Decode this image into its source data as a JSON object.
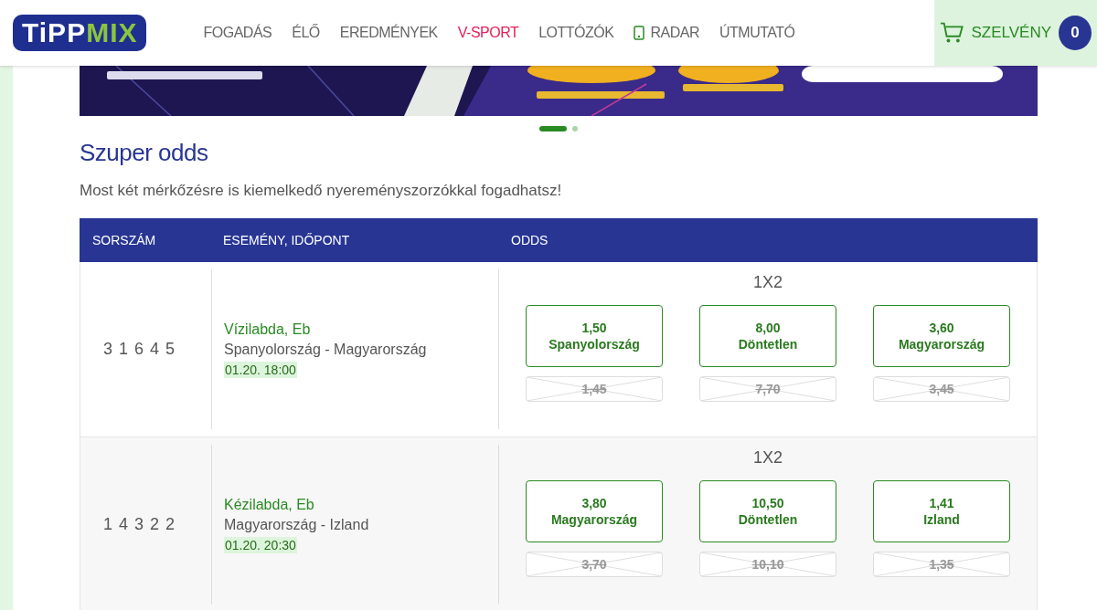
{
  "header": {
    "logo": {
      "part_1": "TiPP",
      "part_2": "MIX"
    },
    "nav": [
      {
        "label": "FOGADÁS",
        "selected": false,
        "icon": false
      },
      {
        "label": "ÉLŐ",
        "selected": false,
        "icon": false
      },
      {
        "label": "EREDMÉNYEK",
        "selected": false,
        "icon": false
      },
      {
        "label": "V-SPORT",
        "selected": true,
        "icon": false
      },
      {
        "label": "LOTTÓZÓK",
        "selected": false,
        "icon": false
      },
      {
        "label": "RADAR",
        "selected": false,
        "icon": true
      },
      {
        "label": "ÚTMUTATÓ",
        "selected": false,
        "icon": false
      }
    ],
    "cart": {
      "label": "SZELVÉNY",
      "count": "0"
    }
  },
  "banner": {
    "kind": "picture",
    "dots": [
      {
        "selected": true
      },
      {
        "selected": false
      }
    ]
  },
  "section": {
    "title": "Szuper odds",
    "subtitle": "Most két mérkőzésre is kiemelkedő nyereményszorzókkal fogadhatsz!"
  },
  "table": {
    "columns": [
      "SORSZÁM",
      "ESEMÉNY, IDŐPONT",
      "ODDS"
    ],
    "rows": [
      {
        "number": "3 1 6 4 5",
        "sport": "Vízilabda, Eb",
        "match": "Spanyolország - Magyarország",
        "time": "01.20. 18:00",
        "market": "1X2",
        "odds": [
          {
            "value": "1,50",
            "label": "Spanyolország",
            "previous": "1,45"
          },
          {
            "value": "8,00",
            "label": "Döntetlen",
            "previous": "7,70"
          },
          {
            "value": "3,60",
            "label": "Magyarország",
            "previous": "3,45"
          }
        ]
      },
      {
        "number": "1 4 3 2 2",
        "sport": "Kézilabda, Eb",
        "match": "Magyarország - Izland",
        "time": "01.20. 20:30",
        "market": "1X2",
        "odds": [
          {
            "value": "3,80",
            "label": "Magyarország",
            "previous": "3,70"
          },
          {
            "value": "10,50",
            "label": "Döntetlen",
            "previous": "10,10"
          },
          {
            "value": "1,41",
            "label": "Izland",
            "previous": "1,35"
          }
        ]
      }
    ]
  }
}
